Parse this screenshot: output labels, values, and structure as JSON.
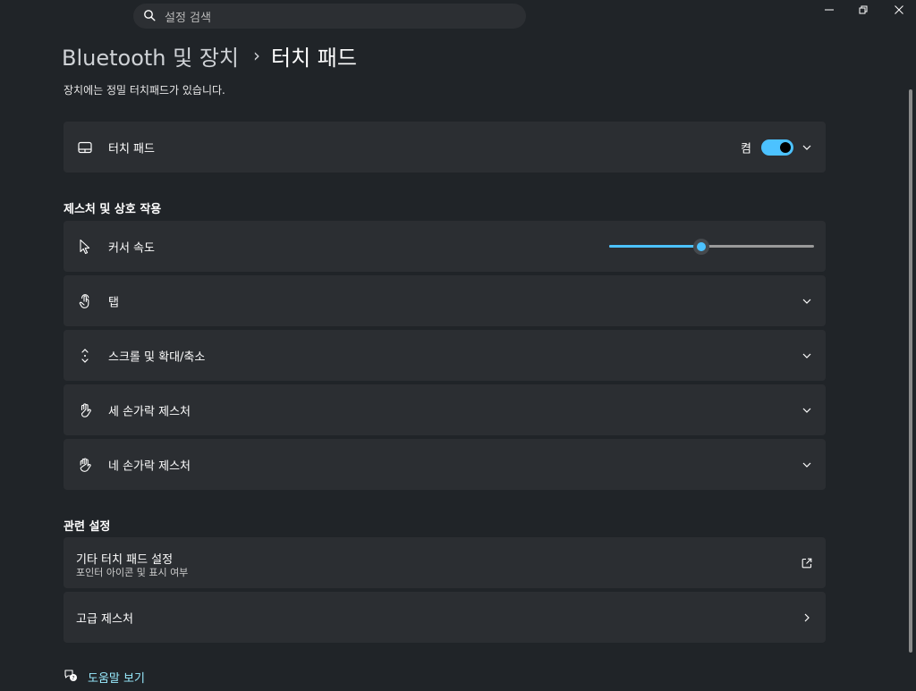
{
  "search": {
    "placeholder": "설정 검색"
  },
  "header": {
    "parent": "Bluetooth 및 장치",
    "separator": "›",
    "current": "터치 패드",
    "description": "장치에는 정밀 터치패드가 있습니다."
  },
  "touchpad_card": {
    "label": "터치 패드",
    "toggle_state": "켬",
    "toggle_on": true
  },
  "gestures_section": {
    "title": "제스처 및 상호 작용",
    "cursor_speed": {
      "label": "커서 속도",
      "value_fraction": 0.45
    },
    "items": [
      {
        "label": "탭",
        "icon": "tap-icon"
      },
      {
        "label": "스크롤 및 확대/축소",
        "icon": "scroll-icon"
      },
      {
        "label": "세 손가락 제스처",
        "icon": "hand-icon"
      },
      {
        "label": "네 손가락 제스처",
        "icon": "hand-icon"
      }
    ]
  },
  "related_section": {
    "title": "관련 설정",
    "other_settings": {
      "title": "기타 터치 패드 설정",
      "subtitle": "포인터 아이콘 및 표시 여부"
    },
    "advanced": {
      "label": "고급 제스처"
    }
  },
  "help": {
    "label": "도움말 보기"
  },
  "colors": {
    "accent": "#4cc2ff",
    "background": "#202428",
    "card": "#2b2e32",
    "link": "#99ebff"
  }
}
